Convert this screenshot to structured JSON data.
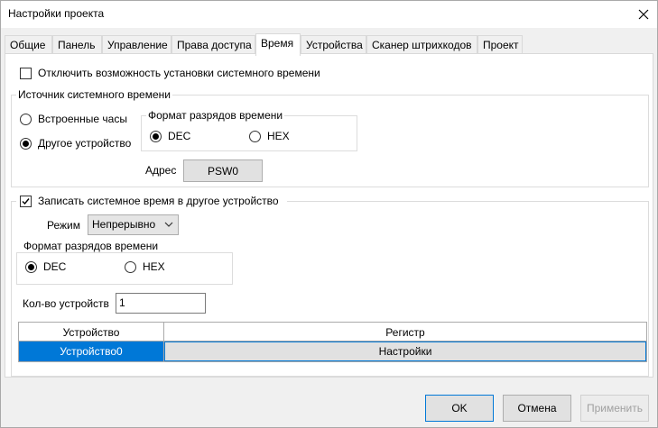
{
  "window": {
    "title": "Настройки проекта"
  },
  "tabs": [
    {
      "label": "Общие"
    },
    {
      "label": "Панель"
    },
    {
      "label": "Управление"
    },
    {
      "label": "Права доступа"
    },
    {
      "label": "Время",
      "active": true
    },
    {
      "label": "Устройства"
    },
    {
      "label": "Сканер штрихкодов"
    },
    {
      "label": "Проект"
    }
  ],
  "time_tab": {
    "disable_set_time": {
      "label": "Отключить возможность установки системного времени",
      "checked": false
    },
    "source_group": {
      "title": "Источник системного времени",
      "builtin_clock": {
        "label": "Встроенные часы",
        "selected": false
      },
      "other_device": {
        "label": "Другое устройство",
        "selected": true
      },
      "format_group": {
        "title": "Формат разрядов времени",
        "dec": {
          "label": "DEC",
          "selected": true
        },
        "hex": {
          "label": "HEX",
          "selected": false
        }
      },
      "address_label": "Адрес",
      "address_value": "PSW0"
    },
    "write_group": {
      "title": "Записать системное время в другое устройство",
      "checked": true,
      "mode_label": "Режим",
      "mode_value": "Непрерывно",
      "format_group": {
        "title": "Формат разрядов времени",
        "dec": {
          "label": "DEC",
          "selected": true
        },
        "hex": {
          "label": "HEX",
          "selected": false
        }
      },
      "device_count_label": "Кол-во устройств",
      "device_count_value": "1",
      "table": {
        "columns": [
          "Устройство",
          "Регистр"
        ],
        "rows": [
          {
            "device": "Устройство0",
            "register": "Настройки"
          }
        ]
      }
    }
  },
  "buttons": {
    "ok": "OK",
    "cancel": "Отмена",
    "apply": "Применить"
  },
  "colors": {
    "selection": "#0078d7",
    "panel": "#ffffff",
    "window": "#f0f0f0"
  }
}
